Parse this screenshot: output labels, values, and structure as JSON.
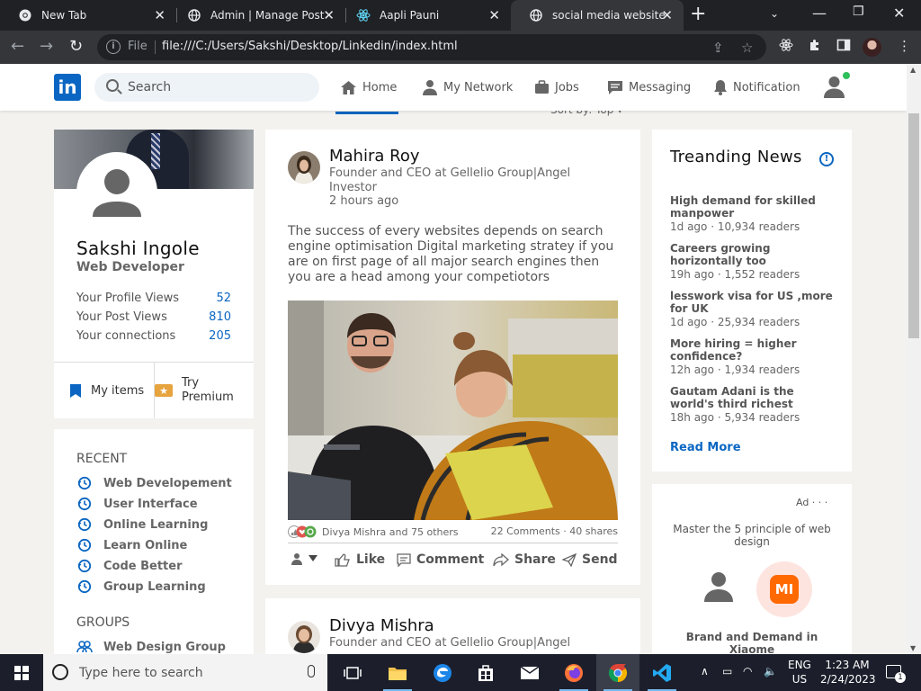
{
  "browser": {
    "tabs": [
      {
        "title": "New Tab",
        "icon": "chrome-icon"
      },
      {
        "title": "Admin | Manage Post",
        "icon": "globe-icon"
      },
      {
        "title": "Aapli Pauni",
        "icon": "react-icon"
      },
      {
        "title": "social media website",
        "icon": "globe-icon",
        "active": true
      }
    ],
    "address": {
      "scheme_label": "File",
      "url": "file:///C:/Users/Sakshi/Desktop/Linkedin/index.html"
    }
  },
  "nav": {
    "logo": "in",
    "search_placeholder": "Search",
    "items": [
      {
        "label": "Home",
        "icon": "home-icon"
      },
      {
        "label": "My Network",
        "icon": "network-icon"
      },
      {
        "label": "Jobs",
        "icon": "briefcase-icon"
      },
      {
        "label": "Messaging",
        "icon": "message-icon"
      },
      {
        "label": "Notification",
        "icon": "bell-icon"
      }
    ],
    "sort_text": "Sort by: Top ▾"
  },
  "profile": {
    "name": "Sakshi Ingole",
    "title": "Web Developer",
    "stats": [
      {
        "label": "Your Profile Views",
        "value": "52"
      },
      {
        "label": "Your Post Views",
        "value": "810"
      },
      {
        "label": "Your connections",
        "value": "205"
      }
    ],
    "my_items_label": "My items",
    "premium_label": "Try Premium"
  },
  "sidebar": {
    "recent_heading": "RECENT",
    "recent": [
      "Web Developement",
      "User Interface",
      "Online Learning",
      "Learn Online",
      "Code Better",
      "Group Learning"
    ],
    "groups_heading": "GROUPS",
    "groups": [
      "Web Design Group"
    ]
  },
  "posts": [
    {
      "author": "Mahira Roy",
      "role": "Founder and CEO at Gellelio Group|Angel Investor",
      "time": "2 hours ago",
      "text": "The success of every websites depends on search engine optimisation Digital marketing stratey if you are on first page of all major search engines then you are a head among your competiotors",
      "reactions_text": "Divya Mishra and 75 others",
      "comments": "22 Comments",
      "shares": "40 shares",
      "actions": [
        "Like",
        "Comment",
        "Share",
        "Send"
      ]
    },
    {
      "author": "Divya Mishra",
      "role": "Founder and CEO at Gellelio Group|Angel"
    }
  ],
  "news": {
    "heading": "Treanding News",
    "items": [
      {
        "title": "High demand for skilled manpower",
        "meta": "1d ago · 10,934 readers"
      },
      {
        "title": "Careers growing horizontally too",
        "meta": "19h ago · 1,552 readers"
      },
      {
        "title": "lesswork visa for US ,more for UK",
        "meta": "1d ago · 25,934 readers"
      },
      {
        "title": "More hiring = higher confidence?",
        "meta": "12h ago · 1,934 readers"
      },
      {
        "title": "Gautam Adani is the world's third richest",
        "meta": "18h ago · 5,934 readers"
      }
    ],
    "read_more": "Read More"
  },
  "ad": {
    "label": "Ad · · ·",
    "text": "Master the 5 principle of web design",
    "brand_logo": "MI",
    "brand_text": "Brand and Demand in Xiaome"
  },
  "taskbar": {
    "search_placeholder": "Type here to search",
    "lang_top": "ENG",
    "lang_bottom": "US",
    "time": "1:23 AM",
    "date": "2/24/2023",
    "notification_count": "1"
  },
  "colors": {
    "brand": "#0a66c2",
    "chrome_dark": "#202124",
    "chrome_mid": "#35363a",
    "page_bg": "#f3f2ef"
  }
}
